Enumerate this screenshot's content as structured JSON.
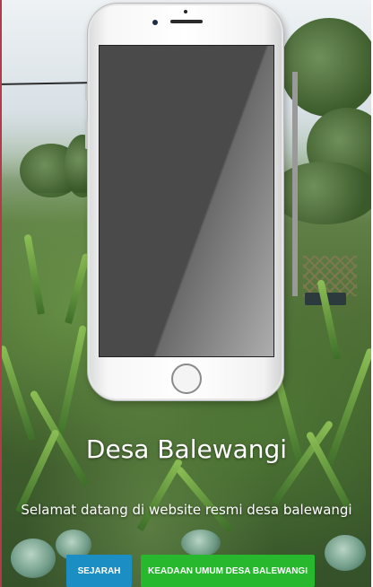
{
  "hero": {
    "title": "Desa Balewangi",
    "subtitle": "Selamat datang di website resmi desa balewangi"
  },
  "buttons": {
    "sejarah": "SEJARAH",
    "keadaan": "KEADAAN UMUM DESA BALEWANGI"
  },
  "colors": {
    "sejarah_button": "#1b8fc4",
    "keadaan_button": "#27b82e"
  },
  "icons": {
    "phone": "phone-mockup-icon"
  }
}
